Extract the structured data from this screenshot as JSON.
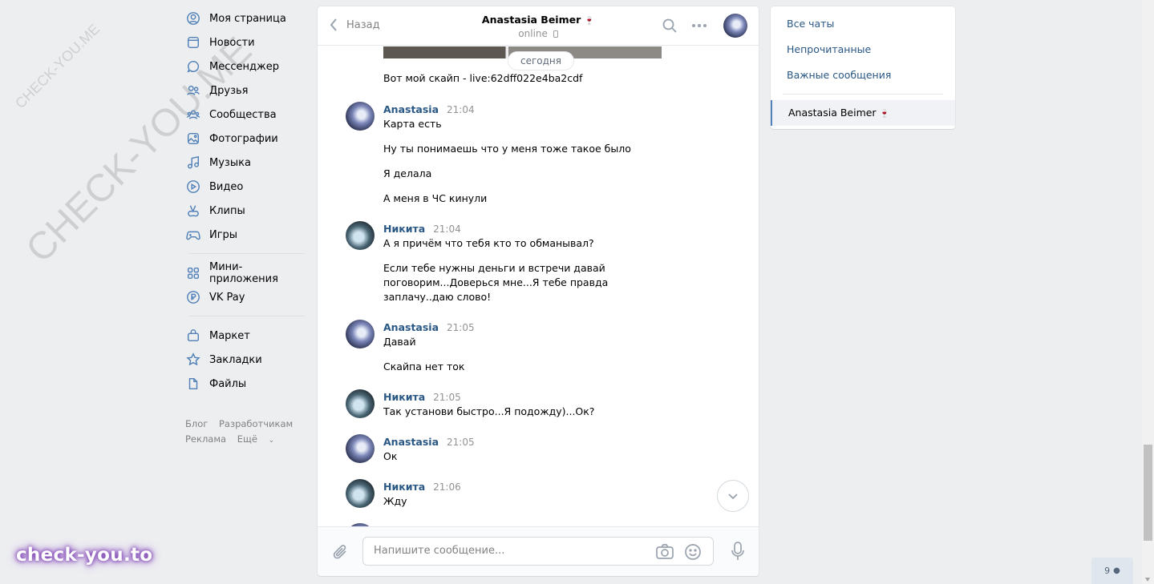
{
  "watermark": {
    "small": "CHECK-YOU.ME",
    "large": "CHECK-YOU.ME",
    "brand": "check-you.to"
  },
  "sidebar": {
    "items": [
      {
        "label": "Моя страница",
        "icon": "user-circle-icon"
      },
      {
        "label": "Новости",
        "icon": "news-icon"
      },
      {
        "label": "Мессенджер",
        "icon": "messenger-icon"
      },
      {
        "label": "Друзья",
        "icon": "friends-icon"
      },
      {
        "label": "Сообщества",
        "icon": "communities-icon"
      },
      {
        "label": "Фотографии",
        "icon": "photos-icon"
      },
      {
        "label": "Музыка",
        "icon": "music-icon"
      },
      {
        "label": "Видео",
        "icon": "video-icon"
      },
      {
        "label": "Клипы",
        "icon": "clips-icon"
      },
      {
        "label": "Игры",
        "icon": "games-icon"
      }
    ],
    "apps": [
      {
        "label": "Мини-приложения",
        "icon": "mini-apps-icon"
      },
      {
        "label": "VK Pay",
        "icon": "vkpay-icon"
      }
    ],
    "extras": [
      {
        "label": "Маркет",
        "icon": "market-icon"
      },
      {
        "label": "Закладки",
        "icon": "bookmarks-icon"
      },
      {
        "label": "Файлы",
        "icon": "files-icon"
      }
    ],
    "footer": {
      "blog": "Блог",
      "dev": "Разработчикам",
      "ads": "Реклама",
      "more": "Ещё"
    }
  },
  "chat": {
    "back_label": "Назад",
    "peer_name": "Anastasia Beimer",
    "peer_emoji": "🍷",
    "peer_status": "online",
    "date_divider": "сегодня",
    "top_message": "Вот мой скайп - live:62dff022e4ba2cdf",
    "groups": [
      {
        "author": "Anastasia",
        "time": "21:04",
        "lines": [
          "Карта есть",
          "Ну ты понимаешь что у меня тоже такое было",
          "Я делала",
          "А меня в ЧС кинули"
        ]
      },
      {
        "author": "Никита",
        "time": "21:04",
        "lines": [
          "А я причём что тебя кто то обманывал?",
          "Если тебе нужны деньги и встречи давай поговорим...Доверься мне...Я тебе правда заплачу..даю слово!"
        ]
      },
      {
        "author": "Anastasia",
        "time": "21:05",
        "lines": [
          "Давай",
          "Скайпа нет ток"
        ]
      },
      {
        "author": "Никита",
        "time": "21:05",
        "lines": [
          "Так установи быстро...Я подожду)...Ок?"
        ]
      },
      {
        "author": "Anastasia",
        "time": "21:05",
        "lines": [
          "Ок"
        ]
      },
      {
        "author": "Никита",
        "time": "21:06",
        "lines": [
          "Жду"
        ]
      }
    ],
    "composer_placeholder": "Напишите сообщение..."
  },
  "right_panel": {
    "all_chats": "Все чаты",
    "unread": "Непрочитанные",
    "important": "Важные сообщения",
    "active_chat": "Anastasia Beimer",
    "active_emoji": "🍷"
  },
  "online_count": "9",
  "colors": {
    "accent": "#5181b8",
    "link": "#2a5885",
    "bg": "#edeef0"
  }
}
